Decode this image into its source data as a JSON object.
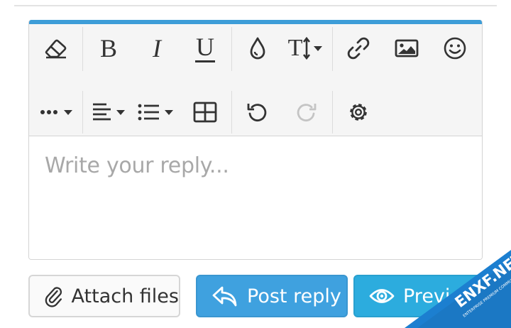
{
  "editor": {
    "placeholder": "Write your reply...",
    "accent_color": "#3d9dd8",
    "toolbar": {
      "row1": [
        {
          "icon": "eraser-icon",
          "label": "Remove formatting"
        },
        {
          "icon": "bold-icon",
          "text": "B"
        },
        {
          "icon": "italic-icon",
          "text": "I"
        },
        {
          "icon": "underline-icon",
          "text": "U"
        },
        {
          "icon": "droplet-icon"
        },
        {
          "icon": "text-size-icon",
          "text": "T"
        },
        {
          "icon": "link-icon"
        },
        {
          "icon": "image-icon"
        },
        {
          "icon": "smiley-icon"
        }
      ],
      "row2": [
        {
          "icon": "more-icon"
        },
        {
          "icon": "align-left-icon"
        },
        {
          "icon": "list-icon"
        },
        {
          "icon": "table-icon"
        },
        {
          "icon": "undo-icon"
        },
        {
          "icon": "redo-icon",
          "disabled": true
        },
        {
          "icon": "gear-icon"
        }
      ]
    }
  },
  "actions": {
    "attach_label": "Attach files",
    "post_label": "Post reply",
    "preview_label": "Previ",
    "post_color": "#3fa1df",
    "preview_color": "#2cacde"
  },
  "watermark": {
    "brand": "ENXF.NET",
    "tagline": "ENTERPRISE PREMIUM COMMUNITY",
    "color": "#1c7fd0"
  }
}
